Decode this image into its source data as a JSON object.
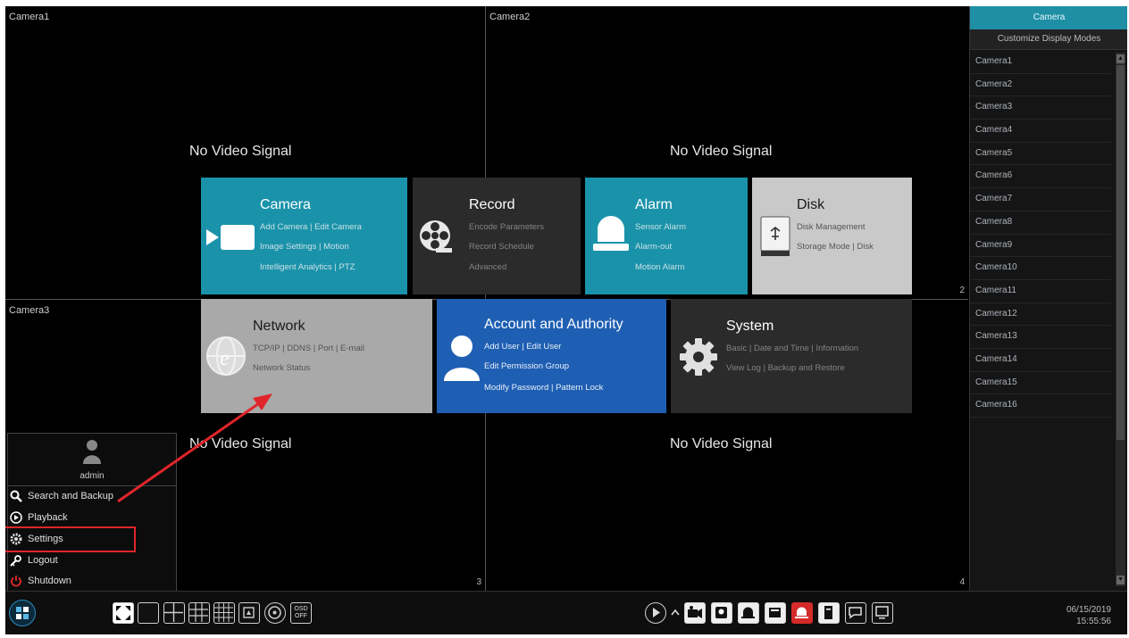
{
  "cameras": [
    {
      "label": "Camera1",
      "status": "No Video Signal",
      "num": ""
    },
    {
      "label": "Camera2",
      "status": "No Video Signal",
      "num": "2"
    },
    {
      "label": "Camera3",
      "status": "No Video Signal",
      "num": "3"
    },
    {
      "label": "",
      "status": "No Video Signal",
      "num": "4"
    }
  ],
  "right_panel": {
    "tab": "Camera",
    "mode": "Customize Display Modes",
    "items": [
      "Camera1",
      "Camera2",
      "Camera3",
      "Camera4",
      "Camera5",
      "Camera6",
      "Camera7",
      "Camera8",
      "Camera9",
      "Camera10",
      "Camera11",
      "Camera12",
      "Camera13",
      "Camera14",
      "Camera15",
      "Camera16"
    ]
  },
  "tiles": {
    "camera": {
      "title": "Camera",
      "lines": [
        "Add Camera | Edit Camera",
        "Image Settings | Motion",
        "Intelligent Analytics | PTZ"
      ],
      "icon": "video-camera-icon"
    },
    "record": {
      "title": "Record",
      "lines": [
        "Encode Parameters",
        "Record Schedule",
        "Advanced"
      ],
      "icon": "film-reel-icon"
    },
    "alarm": {
      "title": "Alarm",
      "lines": [
        "Sensor Alarm",
        "Alarm-out",
        "Motion Alarm"
      ],
      "icon": "alarm-light-icon"
    },
    "disk": {
      "title": "Disk",
      "lines": [
        "Disk Management",
        "Storage Mode | Disk"
      ],
      "icon": "hard-disk-icon"
    },
    "network": {
      "title": "Network",
      "lines": [
        "TCP/IP | DDNS | Port | E-mail",
        "Network Status"
      ],
      "icon": "network-globe-icon"
    },
    "account": {
      "title": "Account and Authority",
      "lines": [
        "Add User | Edit User",
        "Edit Permission Group",
        "Modify Password | Pattern Lock"
      ],
      "icon": "user-icon"
    },
    "system": {
      "title": "System",
      "lines": [
        "Basic | Date and Time | Information",
        "View Log | Backup and Restore"
      ],
      "icon": "gear-icon"
    }
  },
  "user_menu": {
    "user": "admin",
    "items": [
      {
        "label": "Search and Backup",
        "icon": "search-icon"
      },
      {
        "label": "Playback",
        "icon": "play-icon"
      },
      {
        "label": "Settings",
        "icon": "gear-icon"
      },
      {
        "label": "Logout",
        "icon": "logout-icon"
      },
      {
        "label": "Shutdown",
        "icon": "power-icon"
      }
    ]
  },
  "taskbar": {
    "osd": "OSD OFF",
    "date": "06/15/2019",
    "time": "15:55:56"
  },
  "colors": {
    "accent": "#1a93aa",
    "account": "#1f5fb3",
    "highlight": "#e0252b"
  }
}
